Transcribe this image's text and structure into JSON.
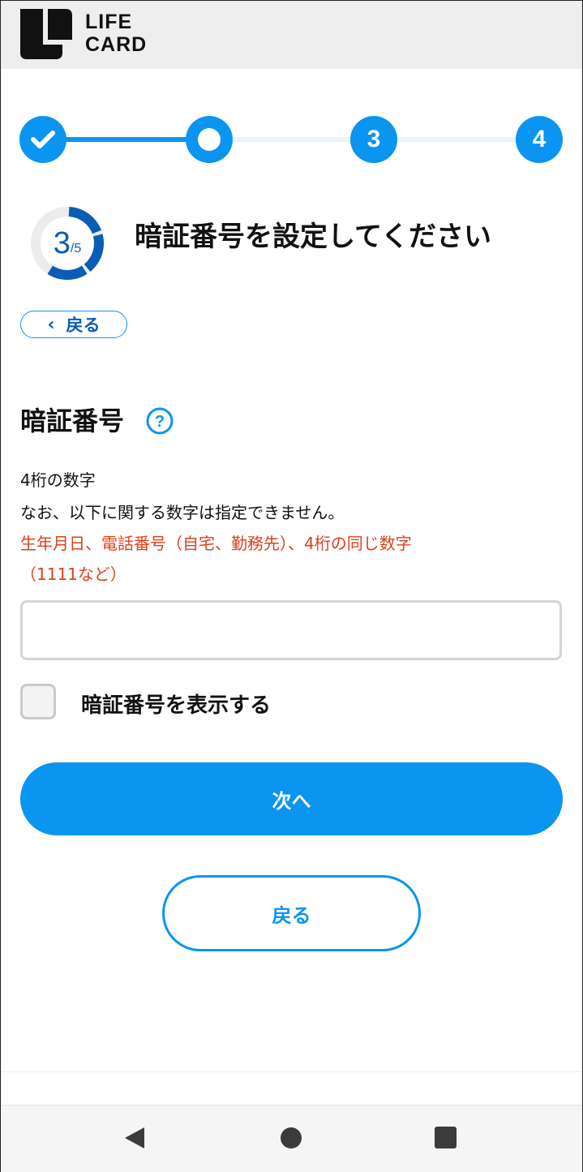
{
  "header": {
    "logo_line1": "LIFE",
    "logo_line2": "CARD"
  },
  "stepper": {
    "steps": [
      {
        "state": "completed",
        "label": ""
      },
      {
        "state": "current",
        "label": ""
      },
      {
        "state": "upcoming",
        "label": "3"
      },
      {
        "state": "upcoming",
        "label": "4"
      }
    ]
  },
  "progress": {
    "current": "3",
    "total": "/5",
    "fraction": 0.6
  },
  "page_title": "暗証番号を設定してください",
  "back_pill": {
    "chevron": "‹",
    "label": "戻る"
  },
  "section": {
    "title": "暗証番号",
    "help_icon": "question-circle-icon",
    "desc_line1": "4桁の数字",
    "desc_line2": "なお、以下に関する数字は指定できません。",
    "warn_line1": "生年月日、電話番号（自宅、勤務先）、4桁の同じ数字",
    "warn_line2": "（1111など）"
  },
  "pin_input": {
    "value": "",
    "placeholder": ""
  },
  "show_pin_checkbox": {
    "label": "暗証番号を表示する",
    "checked": false
  },
  "buttons": {
    "next": "次へ",
    "back": "戻る"
  },
  "colors": {
    "accent": "#0a95f0",
    "accent_dark": "#0a5db3",
    "warning": "#e0401a",
    "track": "#e6f3fb"
  },
  "navbar": {
    "back_icon": "triangle-back-icon",
    "home_icon": "circle-home-icon",
    "recent_icon": "square-recents-icon"
  }
}
